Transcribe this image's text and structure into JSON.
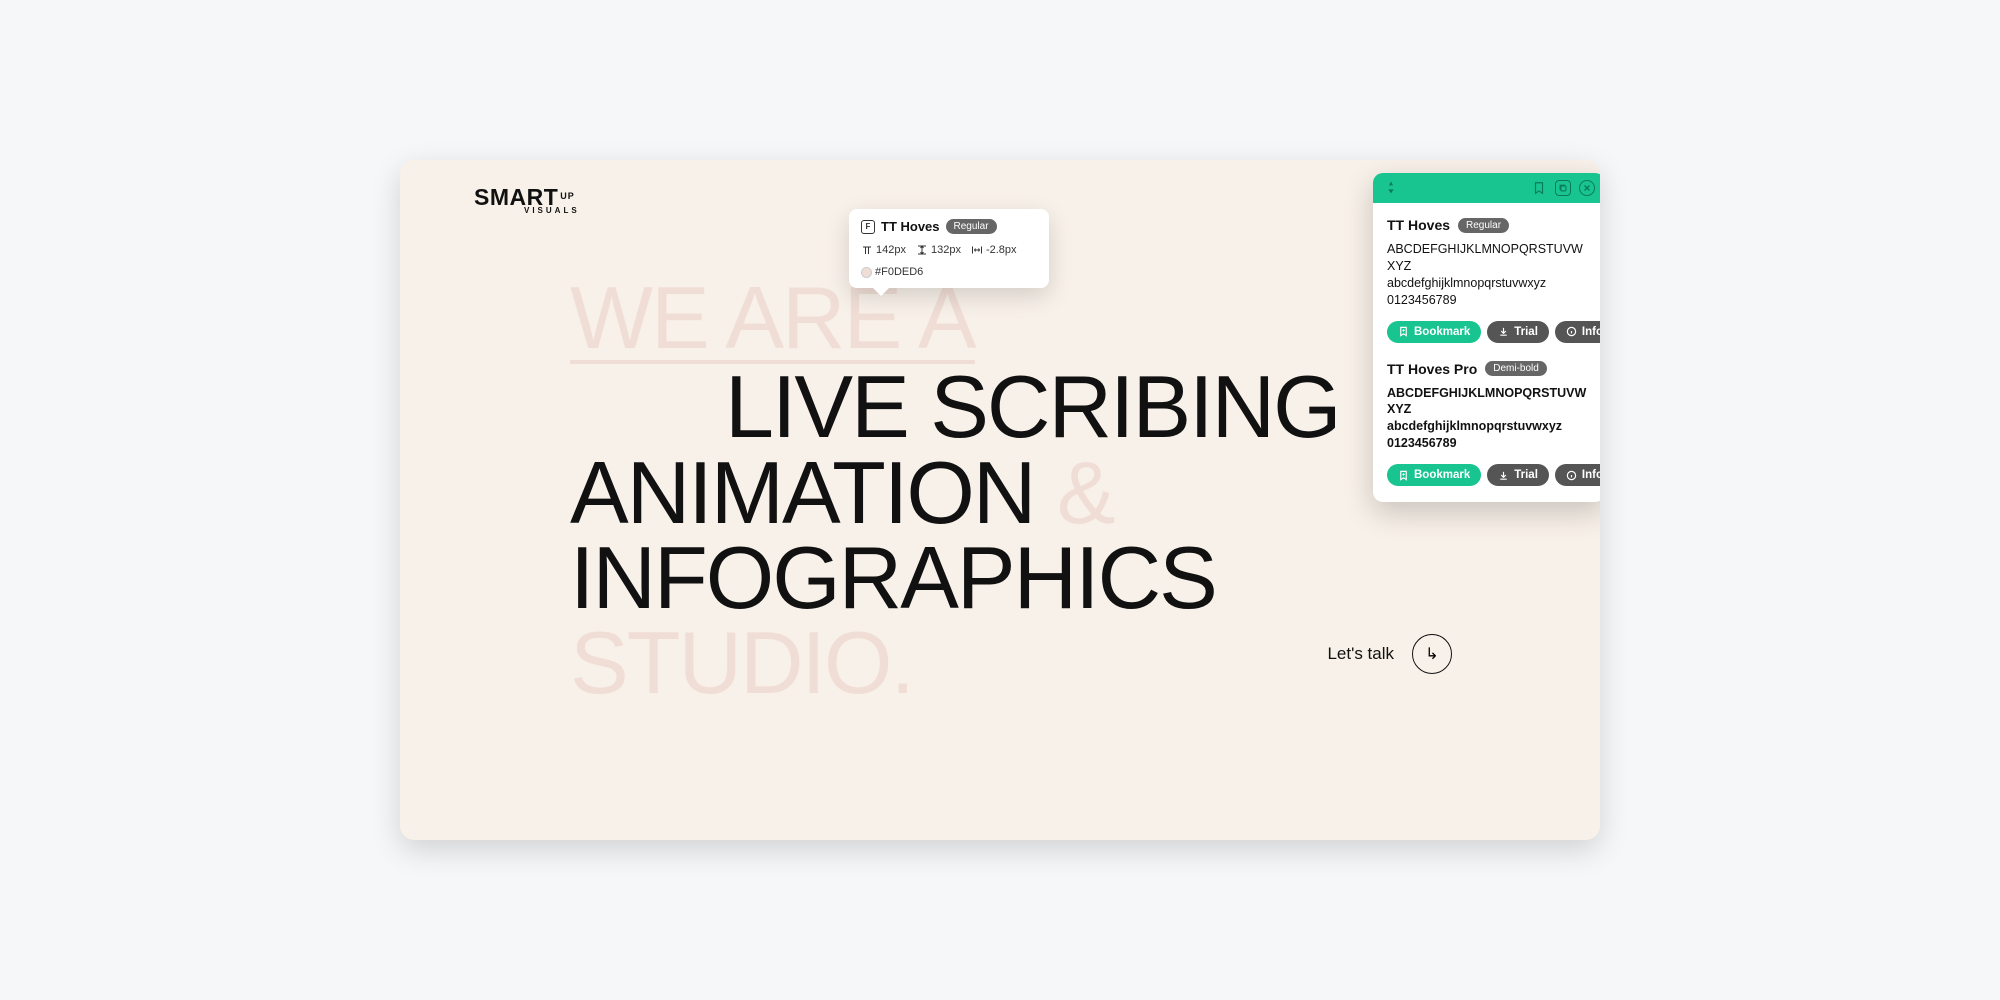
{
  "logo": {
    "main": "SMART",
    "sup": "UP",
    "sub": "VISUALS"
  },
  "hero": {
    "line1": "WE ARE A",
    "line2": "LIVE SCRIBING",
    "line3a": "ANIMATION ",
    "line3b": "&",
    "line4": "INFOGRAPHICS",
    "line5": "STUDIO."
  },
  "cta": {
    "label": "Let's talk",
    "arrow": "↳"
  },
  "inspector": {
    "font_name": "TT Hoves",
    "weight": "Regular",
    "font_size": "142px",
    "line_height": "132px",
    "letter_spacing": "-2.8px",
    "color_hex": "#F0DED6"
  },
  "font_panel": {
    "header_icons": {
      "bookmark_title": "Bookmarks",
      "copy_title": "Copy",
      "close_title": "Close"
    },
    "fonts": [
      {
        "name": "TT Hoves",
        "weight": "Regular",
        "sample_upper": "ABCDEFGHIJKLMNOPQRSTUVWXYZ",
        "sample_lower": "abcdefghijklmnopqrstuvwxyz",
        "sample_digits": "0123456789",
        "bold": false
      },
      {
        "name": "TT Hoves Pro",
        "weight": "Demi-bold",
        "sample_upper": "ABCDEFGHIJKLMNOPQRSTUVWXYZ",
        "sample_lower": "abcdefghijklmnopqrstuvwxyz",
        "sample_digits": "0123456789",
        "bold": true
      }
    ],
    "buttons": {
      "bookmark": "Bookmark",
      "trial": "Trial",
      "info": "Info"
    }
  }
}
